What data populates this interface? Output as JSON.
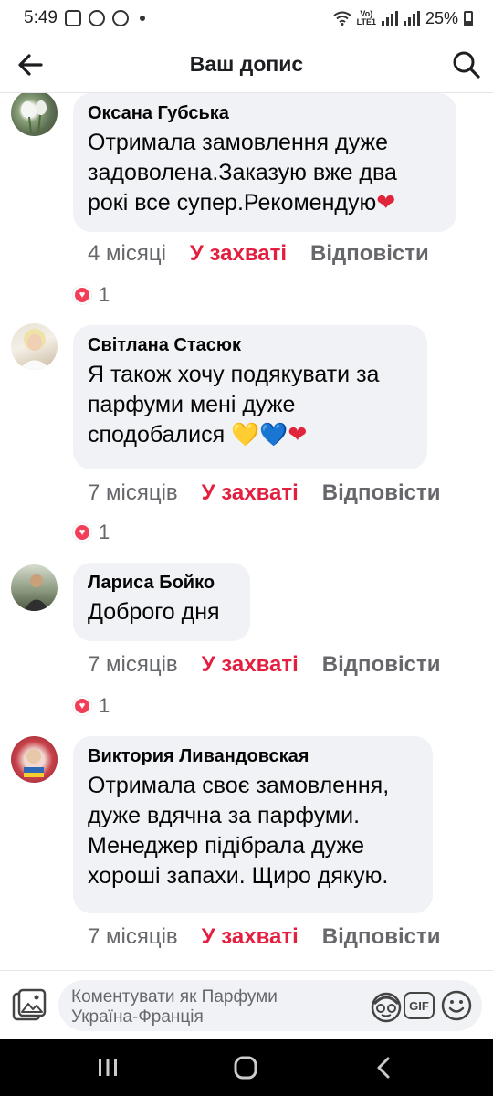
{
  "status_bar": {
    "time": "5:49",
    "network": "LTE1",
    "battery": "25%"
  },
  "header": {
    "title": "Ваш допис"
  },
  "comments": [
    {
      "author": "Оксана Губська",
      "text": "Отримала замовлення дуже задоволена.Заказую вже два рокі все супер.Рекомендую",
      "emoji": "❤",
      "time": "4 місяці",
      "like_label": "У захваті",
      "reply_label": "Відповісти",
      "reaction_count": "1"
    },
    {
      "author": "Світлана Стасюк",
      "text": "Я також хочу подякувати за парфуми мені дуже сподобалися",
      "emoji_1": "💛",
      "emoji_2": "💙",
      "emoji_3": "❤",
      "time": "7 місяців",
      "like_label": "У захваті",
      "reply_label": "Відповісти",
      "reaction_count": "1"
    },
    {
      "author": "Лариса Бойко",
      "text": "Доброго дня",
      "time": "7 місяців",
      "like_label": "У захваті",
      "reply_label": "Відповісти",
      "reaction_count": "1"
    },
    {
      "author": "Виктория Ливандовская",
      "text": "Отримала своє замовлення, дуже вдячна за парфуми. Менеджер підібрала дуже хороші запахи. Щиро дякую.",
      "time": "7 місяців",
      "like_label": "У захваті",
      "reply_label": "Відповісти"
    }
  ],
  "composer": {
    "placeholder": "Коментувати як Парфуми Україна-Франція",
    "gif_label": "GIF"
  },
  "colors": {
    "bubble": "#f0f2f5",
    "like_red": "#e41e3f",
    "muted": "#65676b",
    "love_reaction": "#f33e58"
  }
}
